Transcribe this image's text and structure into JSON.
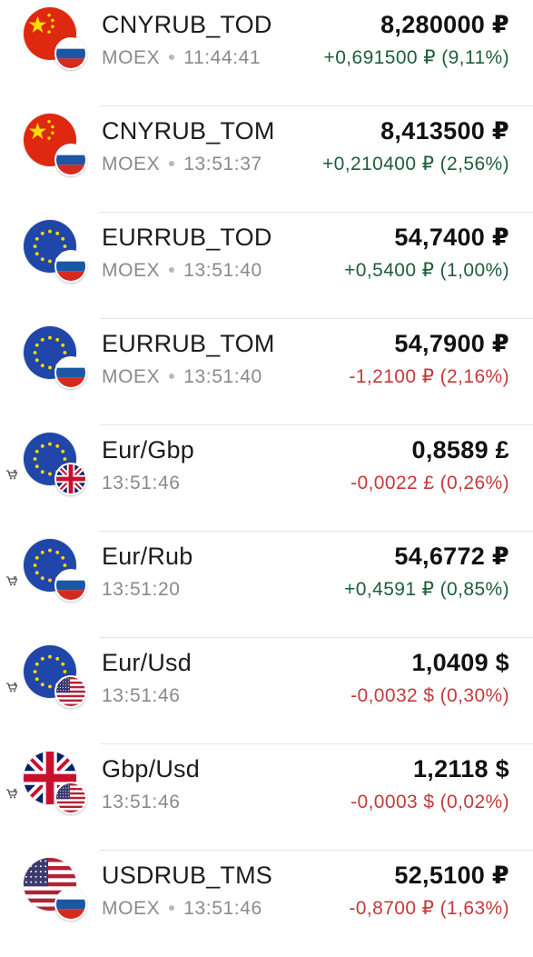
{
  "colors": {
    "positive": "#1f5e3a",
    "negative": "#c43a3a",
    "secondary_text": "#8a8a8a",
    "divider": "#e4e4e4"
  },
  "rows": [
    {
      "name": "CNYRUB_TOD",
      "exchange": "MOEX",
      "time": "11:44:41",
      "price": "8,280000 ₽",
      "change": "+0,691500 ₽ (9,11%)",
      "direction": "up",
      "flag": "cn-flag-icon",
      "sub_flag": "ru-flag-icon",
      "mini_icon": false
    },
    {
      "name": "CNYRUB_TOM",
      "exchange": "MOEX",
      "time": "13:51:37",
      "price": "8,413500 ₽",
      "change": "+0,210400 ₽ (2,56%)",
      "direction": "up",
      "flag": "cn-flag-icon",
      "sub_flag": "ru-flag-icon",
      "mini_icon": false
    },
    {
      "name": "EURRUB_TOD",
      "exchange": "MOEX",
      "time": "13:51:40",
      "price": "54,7400 ₽",
      "change": "+0,5400 ₽ (1,00%)",
      "direction": "up",
      "flag": "eu-flag-icon",
      "sub_flag": "ru-flag-icon",
      "mini_icon": false
    },
    {
      "name": "EURRUB_TOM",
      "exchange": "MOEX",
      "time": "13:51:40",
      "price": "54,7900 ₽",
      "change": "-1,2100 ₽ (2,16%)",
      "direction": "down",
      "flag": "eu-flag-icon",
      "sub_flag": "ru-flag-icon",
      "mini_icon": false
    },
    {
      "name": "Eur/Gbp",
      "exchange": "",
      "time": "13:51:46",
      "price": "0,8589 £",
      "change": "-0,0022 £ (0,26%)",
      "direction": "down",
      "flag": "eu-flag-icon",
      "sub_flag": "gb-flag-icon",
      "mini_icon": true
    },
    {
      "name": "Eur/Rub",
      "exchange": "",
      "time": "13:51:20",
      "price": "54,6772 ₽",
      "change": "+0,4591 ₽ (0,85%)",
      "direction": "up",
      "flag": "eu-flag-icon",
      "sub_flag": "ru-flag-icon",
      "mini_icon": true
    },
    {
      "name": "Eur/Usd",
      "exchange": "",
      "time": "13:51:46",
      "price": "1,0409 $",
      "change": "-0,0032 $ (0,30%)",
      "direction": "down",
      "flag": "eu-flag-icon",
      "sub_flag": "us-flag-icon",
      "mini_icon": true
    },
    {
      "name": "Gbp/Usd",
      "exchange": "",
      "time": "13:51:46",
      "price": "1,2118 $",
      "change": "-0,0003 $ (0,02%)",
      "direction": "down",
      "flag": "gb-flag-icon",
      "sub_flag": "us-flag-icon",
      "mini_icon": true
    },
    {
      "name": "USDRUB_TMS",
      "exchange": "MOEX",
      "time": "13:51:46",
      "price": "52,5100 ₽",
      "change": "-0,8700 ₽ (1,63%)",
      "direction": "down",
      "flag": "us-flag-icon",
      "sub_flag": "ru-flag-icon",
      "mini_icon": false
    }
  ]
}
